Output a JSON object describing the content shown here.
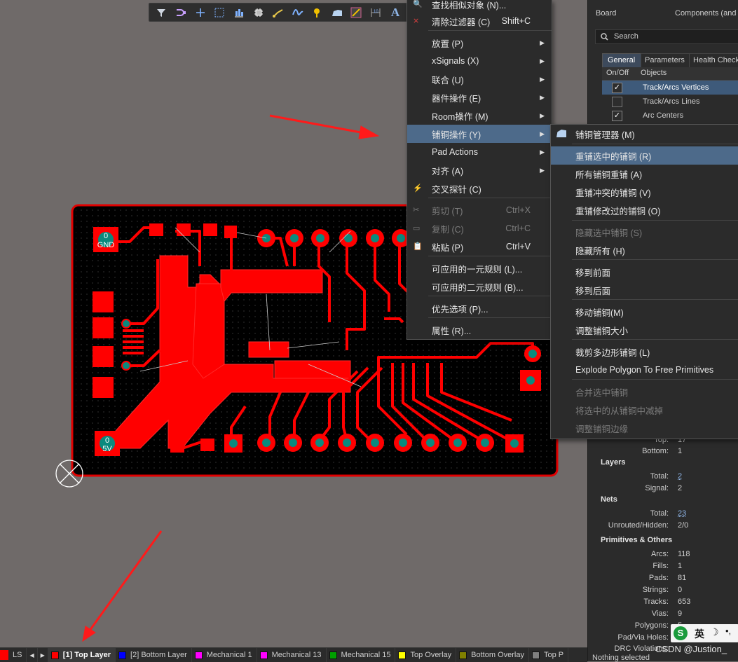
{
  "toolbar": {
    "icons": [
      "filter-icon",
      "route-icon",
      "cross-icon",
      "select-rect-icon",
      "align-icon",
      "component-icon",
      "interactive-route-icon",
      "differential-icon",
      "pin-icon",
      "polygon-icon",
      "keepout-icon",
      "dimension-icon",
      "text-icon"
    ],
    "text_tool": "A"
  },
  "pcb": {
    "gnd_label": "0\nGND",
    "gnd_net": "GND",
    "gnd_num": "0",
    "v5_num": "0",
    "v5_net": "5V"
  },
  "menu1": {
    "items": [
      {
        "label": "查找相似对象 (N)...",
        "shortcut": "",
        "arrow": false,
        "disabled": false
      },
      {
        "label": "清除过滤器 (C)",
        "shortcut": "Shift+C",
        "arrow": false,
        "disabled": false
      },
      {
        "label": "放置 (P)",
        "shortcut": "",
        "arrow": true,
        "disabled": false
      },
      {
        "label": "xSignals (X)",
        "shortcut": "",
        "arrow": true,
        "disabled": false
      },
      {
        "label": "联合 (U)",
        "shortcut": "",
        "arrow": true,
        "disabled": false
      },
      {
        "label": "器件操作 (E)",
        "shortcut": "",
        "arrow": true,
        "disabled": false
      },
      {
        "label": "Room操作 (M)",
        "shortcut": "",
        "arrow": true,
        "disabled": false
      },
      {
        "label": "铺铜操作 (Y)",
        "shortcut": "",
        "arrow": true,
        "disabled": false
      },
      {
        "label": "Pad Actions",
        "shortcut": "",
        "arrow": true,
        "disabled": false
      },
      {
        "label": "对齐 (A)",
        "shortcut": "",
        "arrow": true,
        "disabled": false
      },
      {
        "label": "交叉探针 (C)",
        "shortcut": "",
        "arrow": false,
        "disabled": false
      },
      {
        "label": "剪切 (T)",
        "shortcut": "Ctrl+X",
        "arrow": false,
        "disabled": true
      },
      {
        "label": "复制 (C)",
        "shortcut": "Ctrl+C",
        "arrow": false,
        "disabled": true
      },
      {
        "label": "粘贴 (P)",
        "shortcut": "Ctrl+V",
        "arrow": false,
        "disabled": false
      },
      {
        "label": "可应用的一元规则 (L)...",
        "shortcut": "",
        "arrow": false,
        "disabled": false
      },
      {
        "label": "可应用的二元规则 (B)...",
        "shortcut": "",
        "arrow": false,
        "disabled": false
      },
      {
        "label": "优先选项 (P)...",
        "shortcut": "",
        "arrow": false,
        "disabled": false
      },
      {
        "label": "属性 (R)...",
        "shortcut": "",
        "arrow": false,
        "disabled": false
      }
    ]
  },
  "menu2": {
    "items": [
      {
        "label": "铺铜管理器 (M)",
        "disabled": false
      },
      {
        "label": "重铺选中的铺铜 (R)",
        "disabled": false
      },
      {
        "label": "所有铺铜重铺 (A)",
        "disabled": false
      },
      {
        "label": "重铺冲突的铺铜 (V)",
        "disabled": false
      },
      {
        "label": "重铺修改过的铺铜 (O)",
        "disabled": false
      },
      {
        "label": "隐藏选中铺铜 (S)",
        "disabled": true
      },
      {
        "label": "隐藏所有 (H)",
        "disabled": false
      },
      {
        "label": "移到前面",
        "disabled": false
      },
      {
        "label": "移到后面",
        "disabled": false
      },
      {
        "label": "移动铺铜(M)",
        "disabled": false
      },
      {
        "label": "调整铺铜大小",
        "disabled": false
      },
      {
        "label": "裁剪多边形铺铜 (L)",
        "disabled": false
      },
      {
        "label": "Explode Polygon To Free Primitives",
        "disabled": false
      },
      {
        "label": "合并选中铺铜",
        "disabled": true
      },
      {
        "label": "将选中的从铺铜中减掉",
        "disabled": true
      },
      {
        "label": "调整铺铜边缘",
        "disabled": true
      }
    ]
  },
  "panel": {
    "header_left": "Board",
    "header_right": "Components (and",
    "search_placeholder": "Search",
    "tabs": [
      "General",
      "Parameters",
      "Health Check"
    ],
    "col_onoff": "On/Off",
    "col_objects": "Objects",
    "objects": [
      {
        "name": "Track/Arcs Vertices",
        "on": true
      },
      {
        "name": "Track/Arcs Lines",
        "on": false
      },
      {
        "name": "Arc Centers",
        "on": true
      }
    ],
    "top_label": "Top:",
    "top_val": "17",
    "bottom_label": "Bottom:",
    "bottom_val": "1",
    "layers_title": "Layers",
    "layers_total_label": "Total:",
    "layers_total": "2",
    "layers_signal_label": "Signal:",
    "layers_signal": "2",
    "nets_title": "Nets",
    "nets_total_label": "Total:",
    "nets_total": "23",
    "nets_unrouted_label": "Unrouted/Hidden:",
    "nets_unrouted": "2/0",
    "prims_title": "Primitives & Others",
    "arcs_label": "Arcs:",
    "arcs": "118",
    "fills_label": "Fills:",
    "fills": "1",
    "pads_label": "Pads:",
    "pads": "81",
    "strings_label": "Strings:",
    "strings": "0",
    "tracks_label": "Tracks:",
    "tracks": "653",
    "vias_label": "Vias:",
    "vias": "9",
    "polygons_label": "Polygons:",
    "polygons": "5",
    "padvia_label": "Pad/Via Holes:",
    "drc_label": "DRC Violations:",
    "footer": "Nothing selected",
    "watermark": "CSDN @Justion_",
    "ime_label": "英"
  },
  "layerbar": {
    "ls": "LS",
    "layers": [
      {
        "name": "[1] Top Layer",
        "color": "#ff0000",
        "active": true
      },
      {
        "name": "[2] Bottom Layer",
        "color": "#0000ff",
        "active": false
      },
      {
        "name": "Mechanical 1",
        "color": "#ff00ff",
        "active": false
      },
      {
        "name": "Mechanical 13",
        "color": "#ff00ff",
        "active": false
      },
      {
        "name": "Mechanical 15",
        "color": "#00a000",
        "active": false
      },
      {
        "name": "Top Overlay",
        "color": "#ffff00",
        "active": false
      },
      {
        "name": "Bottom Overlay",
        "color": "#808000",
        "active": false
      },
      {
        "name": "Top P",
        "color": "#808080",
        "active": false
      }
    ]
  }
}
